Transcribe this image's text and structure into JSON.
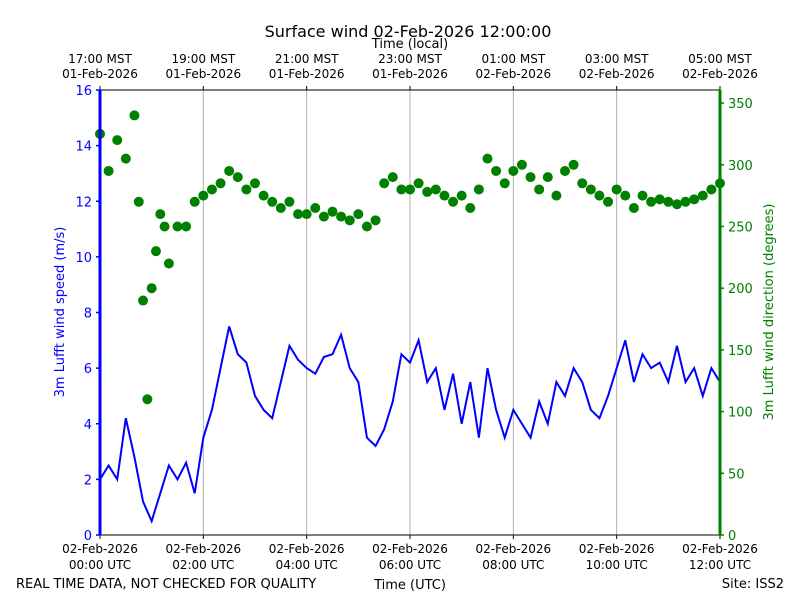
{
  "chart_data": {
    "type": "line",
    "title": "Surface wind 02-Feb-2026 12:00:00",
    "xlabel": "Time (UTC)",
    "top_xlabel": "Time (local)",
    "ylabel_left": "3m Lufft wind speed (m/s)",
    "ylabel_right": "3m Lufft wind direction (degrees)",
    "footer_left": "REAL TIME DATA, NOT CHECKED FOR QUALITY",
    "footer_right": "Site: ISS2",
    "xlim_minutes": [
      0,
      720
    ],
    "ylim_left": [
      0,
      16
    ],
    "ylim_right": [
      0,
      360.6
    ],
    "grid": "vertical",
    "colors": {
      "speed": "#0000ff",
      "direction": "#008000",
      "grid": "#b0b0b0",
      "axis": "#000000"
    },
    "bottom_ticks": [
      {
        "minutes": 0,
        "line1": "02-Feb-2026",
        "line2": "00:00 UTC"
      },
      {
        "minutes": 120,
        "line1": "02-Feb-2026",
        "line2": "02:00 UTC"
      },
      {
        "minutes": 240,
        "line1": "02-Feb-2026",
        "line2": "04:00 UTC"
      },
      {
        "minutes": 360,
        "line1": "02-Feb-2026",
        "line2": "06:00 UTC"
      },
      {
        "minutes": 480,
        "line1": "02-Feb-2026",
        "line2": "08:00 UTC"
      },
      {
        "minutes": 600,
        "line1": "02-Feb-2026",
        "line2": "10:00 UTC"
      },
      {
        "minutes": 720,
        "line1": "02-Feb-2026",
        "line2": "12:00 UTC"
      }
    ],
    "top_ticks": [
      {
        "minutes": 0,
        "line1": "17:00 MST",
        "line2": "01-Feb-2026"
      },
      {
        "minutes": 120,
        "line1": "19:00 MST",
        "line2": "01-Feb-2026"
      },
      {
        "minutes": 240,
        "line1": "21:00 MST",
        "line2": "01-Feb-2026"
      },
      {
        "minutes": 360,
        "line1": "23:00 MST",
        "line2": "01-Feb-2026"
      },
      {
        "minutes": 480,
        "line1": "01:00 MST",
        "line2": "02-Feb-2026"
      },
      {
        "minutes": 600,
        "line1": "03:00 MST",
        "line2": "02-Feb-2026"
      },
      {
        "minutes": 720,
        "line1": "05:00 MST",
        "line2": "02-Feb-2026"
      }
    ],
    "left_ticks": [
      "0",
      "2",
      "4",
      "6",
      "8",
      "10",
      "12",
      "14",
      "16"
    ],
    "right_ticks": [
      "0",
      "50",
      "100",
      "150",
      "200",
      "250",
      "300",
      "350"
    ],
    "series": [
      {
        "name": "wind speed",
        "axis": "left",
        "style": "line",
        "x_step_minutes": 10,
        "values": [
          2.0,
          2.5,
          2.0,
          4.2,
          2.8,
          1.2,
          0.5,
          1.5,
          2.5,
          2.0,
          2.6,
          1.5,
          3.5,
          4.5,
          6.0,
          7.5,
          6.5,
          6.2,
          5.0,
          4.5,
          4.2,
          5.5,
          6.8,
          6.3,
          6.0,
          5.8,
          6.4,
          6.5,
          7.2,
          6.0,
          5.5,
          3.5,
          3.2,
          3.8,
          4.8,
          6.5,
          6.2,
          7.0,
          5.5,
          6.0,
          4.5,
          5.8,
          4.0,
          5.5,
          3.5,
          6.0,
          4.5,
          3.5,
          4.5,
          4.0,
          3.5,
          4.8,
          4.0,
          5.5,
          5.0,
          6.0,
          5.5,
          4.5,
          4.2,
          5.0,
          6.0,
          7.0,
          5.5,
          6.5,
          6.0,
          6.2,
          5.5,
          6.8,
          5.5,
          6.0,
          5.0,
          6.0,
          5.5
        ]
      },
      {
        "name": "wind direction",
        "axis": "right",
        "style": "scatter",
        "x_minutes": [
          0,
          10,
          20,
          30,
          40,
          45,
          50,
          55,
          60,
          65,
          70,
          75,
          80,
          90,
          100,
          110,
          120,
          130,
          140,
          150,
          160,
          170,
          180,
          190,
          200,
          210,
          220,
          230,
          240,
          250,
          260,
          270,
          280,
          290,
          300,
          310,
          320,
          330,
          340,
          350,
          360,
          370,
          380,
          390,
          400,
          410,
          420,
          430,
          440,
          450,
          460,
          470,
          480,
          490,
          500,
          510,
          520,
          530,
          540,
          550,
          560,
          570,
          580,
          590,
          600,
          610,
          620,
          630,
          640,
          650,
          660,
          670,
          680,
          690,
          700,
          710,
          720
        ],
        "values": [
          325,
          295,
          320,
          305,
          340,
          270,
          190,
          110,
          200,
          230,
          260,
          250,
          220,
          250,
          250,
          270,
          275,
          280,
          285,
          295,
          290,
          280,
          285,
          275,
          270,
          265,
          270,
          260,
          260,
          265,
          258,
          262,
          258,
          255,
          260,
          250,
          255,
          285,
          290,
          280,
          280,
          285,
          278,
          280,
          275,
          270,
          275,
          265,
          280,
          305,
          295,
          285,
          295,
          300,
          290,
          280,
          290,
          275,
          295,
          300,
          285,
          280,
          275,
          270,
          280,
          275,
          265,
          275,
          270,
          272,
          270,
          268,
          270,
          272,
          275,
          280,
          285
        ]
      }
    ]
  }
}
